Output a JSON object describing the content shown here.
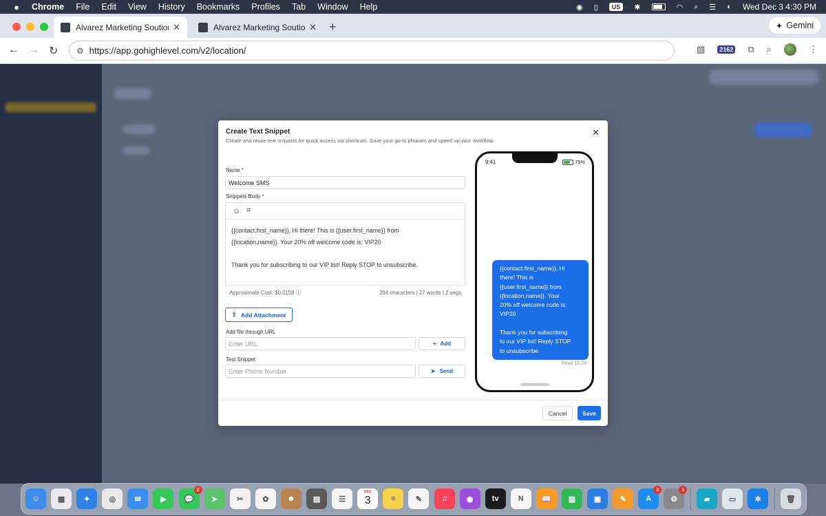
{
  "menubar": {
    "app": "Chrome",
    "items": [
      "File",
      "Edit",
      "View",
      "History",
      "Bookmarks",
      "Profiles",
      "Tab",
      "Window",
      "Help"
    ],
    "input_source": "US",
    "clock": "Wed Dec 3  4:30 PM"
  },
  "browser": {
    "tabs": [
      {
        "title": "Alvarez Marketing Soutions"
      },
      {
        "title": "Alvarez Marketing Soutions"
      }
    ],
    "gemini_label": "Gemini",
    "url": "https://app.gohighlevel.com/v2/location/",
    "extension_badge": "2162"
  },
  "modal": {
    "title": "Create Text Snippet",
    "subtitle": "Create and reuse text snippets for quick access via shortcuts. Save your go-to phrases and speed up your workflow.",
    "name_label": "Name",
    "name_value": "Welcome SMS",
    "body_label": "Snippets Body",
    "body_lines": [
      "{{contact.first_name}}, Hi there! This is {{user.first_name}} from",
      "{{location.name}}. Your 20% off welcome code is: VIP20",
      "",
      "Thank you for subscribing to our VIP list! Reply STOP to unsubscribe."
    ],
    "cost_label": "Approximate Cost: $0.0158",
    "stats": "204 characters | 27 words | 2 segs",
    "add_attachment": "Add Attachment",
    "url_label": "Add file through URL",
    "url_placeholder": "Enter URL",
    "add_button": "Add",
    "test_label": "Test Snippet",
    "phone_placeholder": "Enter Phone Number",
    "send_button": "Send",
    "cancel_button": "Cancel",
    "save_button": "Save"
  },
  "preview": {
    "time": "9:41",
    "battery": "75%",
    "battery_level": 0.75,
    "bubble_lines": [
      "{{contact.first_name}}, Hi",
      "there! This is",
      "{{user.first_name}} from",
      "{{location.name}}. Your",
      "20% off welcome code is:",
      "VIP20",
      "",
      "Thank you for subscribing",
      "to our VIP list! Reply STOP",
      "to unsubscribe."
    ],
    "read_status": "Read 15:29"
  },
  "colors": {
    "primary": "#1b6ee6",
    "required": "#d93025",
    "battery_green": "#2fb24d"
  },
  "dock": {
    "apps": [
      {
        "name": "finder",
        "color": "#3c8be8",
        "glyph": "☺"
      },
      {
        "name": "launchpad",
        "color": "#e8e8ee",
        "glyph": "▦"
      },
      {
        "name": "safari",
        "color": "#2f83e6",
        "glyph": "✦"
      },
      {
        "name": "chrome",
        "color": "#e9e9e9",
        "glyph": "◎"
      },
      {
        "name": "mail",
        "color": "#3a8ef0",
        "glyph": "✉"
      },
      {
        "name": "facetime",
        "color": "#34c759",
        "glyph": "▶"
      },
      {
        "name": "messages",
        "color": "#35c759",
        "glyph": "💬",
        "badge": "2"
      },
      {
        "name": "maps",
        "color": "#5cc26b",
        "glyph": "➤"
      },
      {
        "name": "capcut",
        "color": "#f2f2f2",
        "glyph": "✂"
      },
      {
        "name": "photos",
        "color": "#f4f4f4",
        "glyph": "✿"
      },
      {
        "name": "contacts",
        "color": "#b88552",
        "glyph": "☻"
      },
      {
        "name": "calculator",
        "color": "#5a5a5a",
        "glyph": "▤"
      },
      {
        "name": "reminders",
        "color": "#f4f4f4",
        "glyph": "☰"
      },
      {
        "name": "calendar",
        "color": "#ffffff",
        "month": "DEC",
        "day": "3"
      },
      {
        "name": "notes",
        "color": "#f6d24a",
        "glyph": "≡"
      },
      {
        "name": "freeform",
        "color": "#f4f4f4",
        "glyph": "✎"
      },
      {
        "name": "music",
        "color": "#f5415a",
        "glyph": "♫"
      },
      {
        "name": "podcasts",
        "color": "#9b4fd9",
        "glyph": "◉"
      },
      {
        "name": "tv",
        "color": "#1c1c1e",
        "glyph": "tv"
      },
      {
        "name": "news",
        "color": "#f4f4f4",
        "glyph": "N"
      },
      {
        "name": "books",
        "color": "#f59a23",
        "glyph": "📖"
      },
      {
        "name": "numbers",
        "color": "#31b855",
        "glyph": "▥"
      },
      {
        "name": "keynote",
        "color": "#2e7de0",
        "glyph": "▣"
      },
      {
        "name": "pages",
        "color": "#f49a2a",
        "glyph": "✎"
      },
      {
        "name": "app-store",
        "color": "#1f8cf0",
        "glyph": "A",
        "badge": "3"
      },
      {
        "name": "system-settings",
        "color": "#8a8a8e",
        "glyph": "⚙",
        "badge": "1"
      },
      {
        "name": "stickies",
        "color": "#1aa6c9",
        "glyph": "▰"
      },
      {
        "name": "preview",
        "color": "#dfe6ee",
        "glyph": "▭"
      },
      {
        "name": "xcode",
        "color": "#1a7fe6",
        "glyph": "✲"
      },
      {
        "name": "trash",
        "color": "#d7dce2",
        "glyph": "🗑"
      }
    ]
  }
}
